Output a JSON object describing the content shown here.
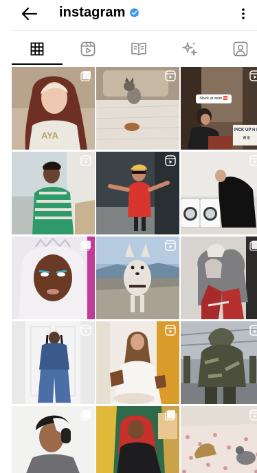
{
  "header": {
    "username": "instagram",
    "back_icon": "arrow-left-icon",
    "verified_icon": "verified-badge-icon",
    "more_icon": "more-vertical-icon",
    "verified_color": "#3897f0"
  },
  "tabs": [
    {
      "name": "posts",
      "icon": "grid-icon",
      "selected": true
    },
    {
      "name": "reels",
      "icon": "reels-icon",
      "selected": false
    },
    {
      "name": "guides",
      "icon": "guide-book-icon",
      "selected": false
    },
    {
      "name": "effects",
      "icon": "sparkles-icon",
      "selected": false
    },
    {
      "name": "tagged",
      "icon": "tagged-person-icon",
      "selected": false
    }
  ],
  "posts": [
    {
      "type": "photo",
      "caption": ""
    },
    {
      "type": "reel",
      "caption": ""
    },
    {
      "type": "reel",
      "caption": "Stuck at work 🆘",
      "sign": "PICK UP H E R E"
    },
    {
      "type": "reel",
      "caption": ""
    },
    {
      "type": "reel",
      "caption": ""
    },
    {
      "type": "reel",
      "caption": ""
    },
    {
      "type": "photo",
      "caption": ""
    },
    {
      "type": "reel",
      "caption": ""
    },
    {
      "type": "photo",
      "caption": ""
    },
    {
      "type": "photo",
      "caption": ""
    },
    {
      "type": "reel",
      "caption": ""
    },
    {
      "type": "reel",
      "caption": ""
    },
    {
      "type": "photo",
      "caption": ""
    },
    {
      "type": "photo",
      "caption": ""
    },
    {
      "type": "reel",
      "caption": ""
    }
  ]
}
